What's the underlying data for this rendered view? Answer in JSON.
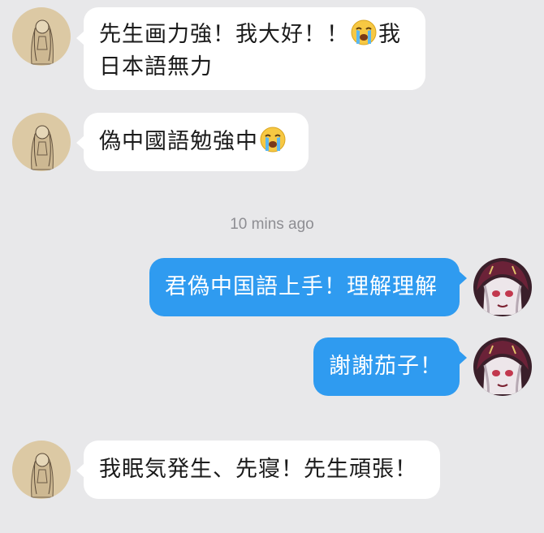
{
  "colors": {
    "background": "#e8e8ea",
    "incoming_bubble": "#ffffff",
    "outgoing_bubble": "#2f9bf0",
    "timestamp": "#8e8e93"
  },
  "messages": [
    {
      "direction": "incoming",
      "avatar": "sketch-girl-avatar",
      "line1_a": "先生画力強！我大好！！",
      "emoji": "crying-face-emoji",
      "line1_b": "我",
      "line2": "日本語無力"
    },
    {
      "direction": "incoming",
      "avatar": "sketch-girl-avatar",
      "text": "偽中國語勉強中",
      "emoji": "crying-face-emoji"
    },
    {
      "direction": "outgoing",
      "avatar": "anime-girl-avatar",
      "text": "君偽中国語上手！理解理解"
    },
    {
      "direction": "outgoing",
      "avatar": "anime-girl-avatar",
      "text": "謝謝茄子！"
    },
    {
      "direction": "incoming",
      "avatar": "sketch-girl-avatar",
      "text": "我眠気発生、先寝！先生頑張！"
    }
  ],
  "timestamp": "10 mins ago"
}
